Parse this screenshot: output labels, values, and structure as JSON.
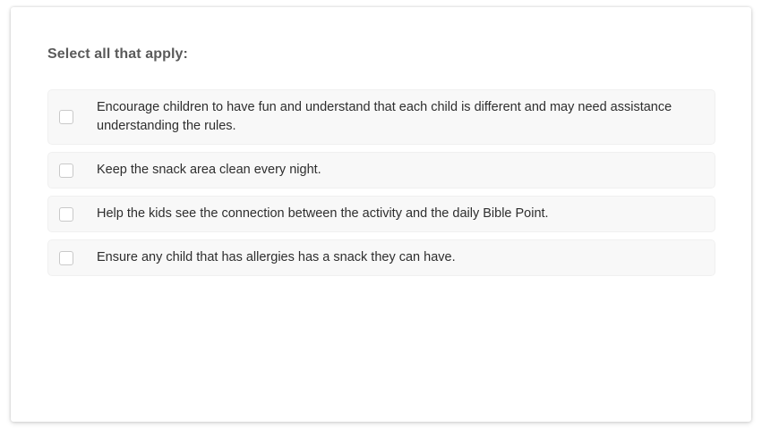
{
  "question": {
    "prompt": "Select all that apply:"
  },
  "options": [
    {
      "label": "Encourage children to have fun and understand that each child is different and may need assistance understanding the rules.",
      "checked": false
    },
    {
      "label": "Keep the snack area clean every night.",
      "checked": false
    },
    {
      "label": "Help the kids see the connection between the activity and the daily Bible Point.",
      "checked": false
    },
    {
      "label": "Ensure any child that has allergies has a snack they can have.",
      "checked": false
    }
  ],
  "colors": {
    "prompt_text": "#5a5a5a",
    "option_background": "#f8f8f8",
    "checkbox_border": "#c9c9c9"
  }
}
